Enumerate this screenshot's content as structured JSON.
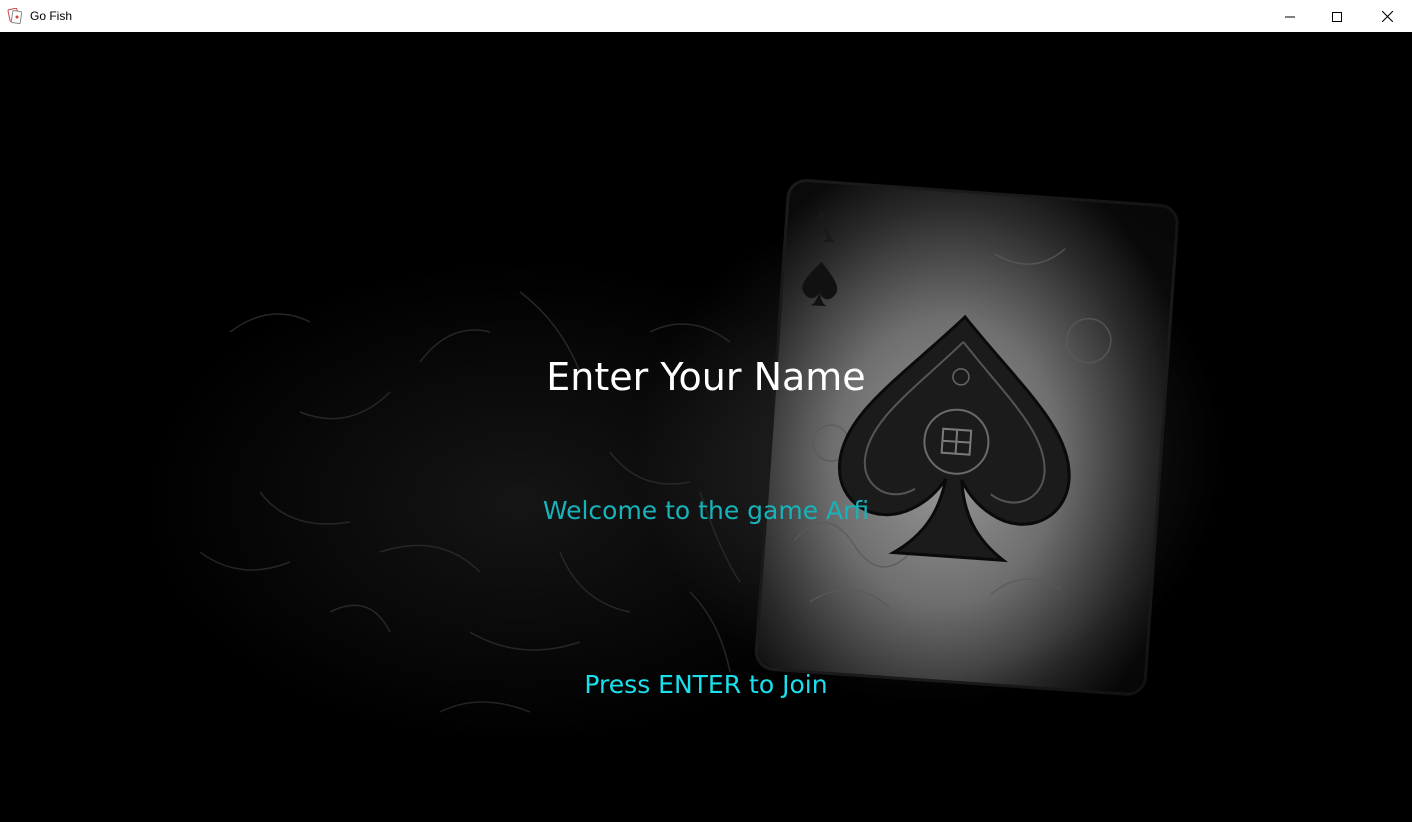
{
  "window": {
    "title": "Go Fish",
    "controls": [
      "minimize-icon",
      "maximize-icon",
      "close-icon"
    ]
  },
  "screen": {
    "heading": "Enter Your Name",
    "welcome_message": "Welcome to the game Arfi",
    "prompt": "Press ENTER to Join"
  },
  "background": {
    "card_rank": "A",
    "card_suit": "spade-icon"
  },
  "colors": {
    "heading": "#ffffff",
    "welcome": "#17b3b9",
    "prompt": "#19e0ec",
    "background": "#000000"
  }
}
